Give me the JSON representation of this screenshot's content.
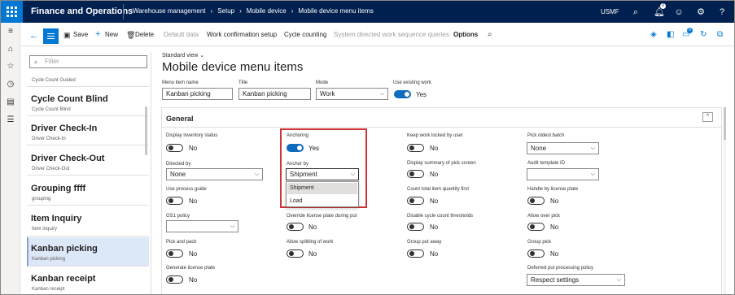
{
  "app": {
    "name": "Finance and Operations",
    "company": "USMF"
  },
  "breadcrumb": [
    "Warehouse management",
    "Setup",
    "Mobile device",
    "Mobile device menu items"
  ],
  "topbar_badge": "0",
  "actions": {
    "save": "Save",
    "new": "New",
    "delete": "Delete",
    "default_data": "Default data",
    "work_confirmation": "Work confirmation setup",
    "cycle_counting": "Cycle counting",
    "system_directed": "System directed work sequence queries",
    "options": "Options",
    "badge": "0"
  },
  "sidebar": {
    "filter_placeholder": "Filter",
    "items": [
      {
        "title": "",
        "sub": "Cycle Count Guided"
      },
      {
        "title": "Cycle Count Blind",
        "sub": "Cycle Count Blind"
      },
      {
        "title": "Driver Check-In",
        "sub": "Driver Check-In"
      },
      {
        "title": "Driver Check-Out",
        "sub": "Driver Check-Out"
      },
      {
        "title": "Grouping ffff",
        "sub": "grouping"
      },
      {
        "title": "Item Inquiry",
        "sub": "Item inquiry"
      },
      {
        "title": "Kanban picking",
        "sub": "Kanban picking"
      },
      {
        "title": "Kanban receipt",
        "sub": "Kanban receipt"
      }
    ]
  },
  "page": {
    "view": "Standard view",
    "title": "Mobile device menu items"
  },
  "header_fields": {
    "menu_item_name": {
      "label": "Menu item name",
      "value": "Kanban picking"
    },
    "title": {
      "label": "Title",
      "value": "Kanban picking"
    },
    "mode": {
      "label": "Mode",
      "value": "Work"
    },
    "use_existing_work": {
      "label": "Use existing work",
      "value": "Yes"
    }
  },
  "general": {
    "title": "General",
    "col1": {
      "display_inventory_status": {
        "label": "Display inventory status",
        "value": "No"
      },
      "directed_by": {
        "label": "Directed by",
        "value": "None"
      },
      "use_process_guide": {
        "label": "Use process guide",
        "value": "No"
      },
      "gs1_policy": {
        "label": "GS1 policy",
        "value": ""
      },
      "pick_and_pack": {
        "label": "Pick and pack",
        "value": "No"
      },
      "generate_license_plate": {
        "label": "Generate license plate",
        "value": "No"
      }
    },
    "col2": {
      "anchoring": {
        "label": "Anchoring",
        "value": "Yes"
      },
      "anchor_by": {
        "label": "Anchor by",
        "value": "Shipment",
        "options": [
          "Shipment",
          "Load"
        ]
      },
      "override_lp": {
        "label": "Override license plate during put",
        "value": "No"
      },
      "allow_splitting": {
        "label": "Allow splitting of work",
        "value": "No"
      }
    },
    "col3": {
      "keep_work_locked": {
        "label": "Keep work locked by user",
        "value": "No"
      },
      "display_summary": {
        "label": "Display summary of pick screen",
        "value": "No"
      },
      "count_total": {
        "label": "Count total item quantity first",
        "value": "No"
      },
      "disable_cycle": {
        "label": "Disable cycle count thresholds",
        "value": "No"
      },
      "group_put_away": {
        "label": "Group put away",
        "value": "No"
      }
    },
    "col4": {
      "pick_oldest_batch": {
        "label": "Pick oldest batch",
        "value": "None"
      },
      "audit_template": {
        "label": "Audit template ID",
        "value": ""
      },
      "handle_by_lp": {
        "label": "Handle by license plate",
        "value": "No"
      },
      "allow_over_pick": {
        "label": "Allow over pick",
        "value": "No"
      },
      "group_pick": {
        "label": "Group pick",
        "value": "No"
      },
      "deferred_put": {
        "label": "Deferred put processing policy",
        "value": "Respect settings"
      }
    }
  }
}
